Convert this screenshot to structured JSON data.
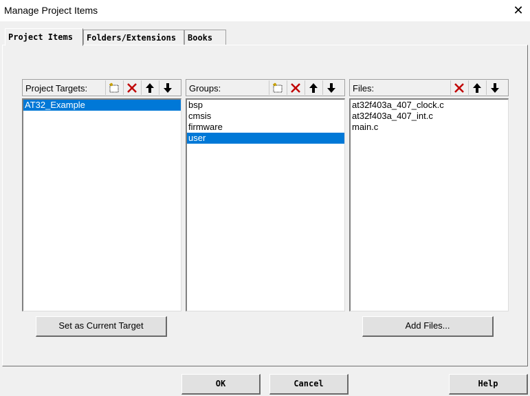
{
  "window": {
    "title": "Manage Project Items",
    "close_glyph": "✕"
  },
  "tabs": [
    {
      "label": "Project Items",
      "active": true
    },
    {
      "label": "Folders/Extensions",
      "active": false
    },
    {
      "label": "Books",
      "active": false
    }
  ],
  "targets": {
    "label": "Project Targets:",
    "items": [
      "AT32_Example"
    ],
    "selected": 0,
    "button_label": "Set as Current Target"
  },
  "groups": {
    "label": "Groups:",
    "items": [
      "bsp",
      "cmsis",
      "firmware",
      "user"
    ],
    "selected": 3
  },
  "files": {
    "label": "Files:",
    "items": [
      "at32f403a_407_clock.c",
      "at32f403a_407_int.c",
      "main.c"
    ],
    "button_label": "Add Files..."
  },
  "footer": {
    "ok_label": "OK",
    "cancel_label": "Cancel",
    "help_label": "Help"
  },
  "colors": {
    "selection": "#0078d7",
    "delete_icon": "#c00000"
  }
}
